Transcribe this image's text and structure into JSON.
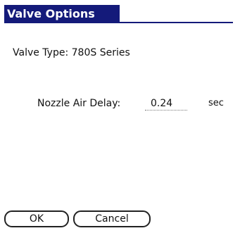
{
  "dialog": {
    "title": "Valve Options"
  },
  "valve_type": {
    "label": "Valve Type:",
    "value": "780S Series"
  },
  "nozzle_air_delay": {
    "label": "Nozzle Air Delay:",
    "value": "0.24",
    "unit": "sec"
  },
  "buttons": {
    "ok_label": "OK",
    "cancel_label": "Cancel"
  },
  "colors": {
    "title_bar": "#141a7a",
    "title_text": "#ffffff",
    "background": "#ffffff"
  }
}
